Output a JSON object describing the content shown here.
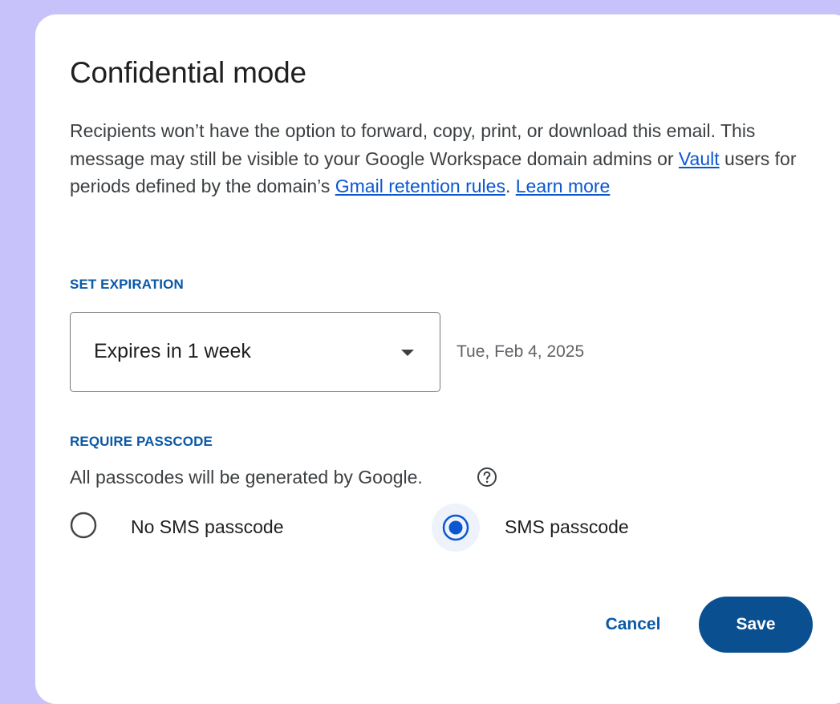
{
  "dialog": {
    "title": "Confidential mode",
    "description": {
      "text_1": "Recipients won’t have the option to forward, copy, print, or download this email. This message may still be visible to your Google Workspace domain admins or ",
      "link_vault": "Vault",
      "text_2": " users for periods defined by the domain’s ",
      "link_retention": "Gmail retention rules",
      "text_3": ". ",
      "link_learn_more": "Learn more"
    },
    "expiration": {
      "section_label": "SET EXPIRATION",
      "selected_value": "Expires in 1 week",
      "date": "Tue, Feb 4, 2025"
    },
    "passcode": {
      "section_label": "REQUIRE PASSCODE",
      "note": "All passcodes will be generated by Google.",
      "options": [
        {
          "label": "No SMS passcode",
          "selected": false
        },
        {
          "label": "SMS passcode",
          "selected": true
        }
      ]
    },
    "actions": {
      "cancel_label": "Cancel",
      "save_label": "Save"
    }
  },
  "colors": {
    "background": "#c8c2fb",
    "accent": "#0b57d0",
    "save_button": "#0a4f8f",
    "section_label": "#0a58a6"
  },
  "icons": {
    "help": "help-circle-icon",
    "dropdown": "chevron-down-icon"
  }
}
